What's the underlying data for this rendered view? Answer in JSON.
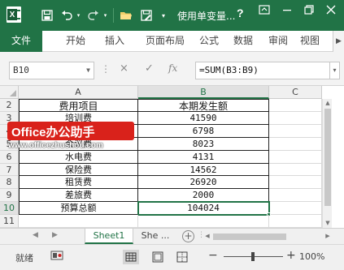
{
  "app": {
    "title": "使用单变量...",
    "help": "?",
    "accent": "#217346"
  },
  "ribbon": {
    "tabs": [
      "文件",
      "开始",
      "插入",
      "页面布局",
      "公式",
      "数据",
      "审阅",
      "视图"
    ]
  },
  "formula_bar": {
    "name_box": "B10",
    "cancel_icon": "×",
    "enter_icon": "✓",
    "fx_label": "fx",
    "formula": "=SUM(B3:B9)"
  },
  "grid": {
    "columns": [
      "A",
      "B",
      "C"
    ],
    "selected_column": "B",
    "rows": [
      {
        "num": "2",
        "a": "费用项目",
        "b": "本期发生额"
      },
      {
        "num": "3",
        "a": "培训费",
        "b": "41590"
      },
      {
        "num": "4",
        "a": "办公费",
        "b": "6798"
      },
      {
        "num": "5",
        "a": "会议费",
        "b": "8023"
      },
      {
        "num": "6",
        "a": "水电费",
        "b": "4131"
      },
      {
        "num": "7",
        "a": "保险费",
        "b": "14562"
      },
      {
        "num": "8",
        "a": "租赁费",
        "b": "26920"
      },
      {
        "num": "9",
        "a": "差旅费",
        "b": "2000"
      },
      {
        "num": "10",
        "a": "预算总额",
        "b": "104024"
      },
      {
        "num": "11",
        "a": "",
        "b": ""
      }
    ],
    "selected_cell": "B10"
  },
  "watermark": {
    "badge": "Office办公助手",
    "url": "www.officezhushou.com"
  },
  "sheets": {
    "tabs": [
      "Sheet1",
      "She ..."
    ],
    "active": "Sheet1",
    "add_label": "+"
  },
  "status": {
    "ready": "就绪",
    "zoom": "100%",
    "zoom_minus": "−",
    "zoom_plus": "+"
  }
}
